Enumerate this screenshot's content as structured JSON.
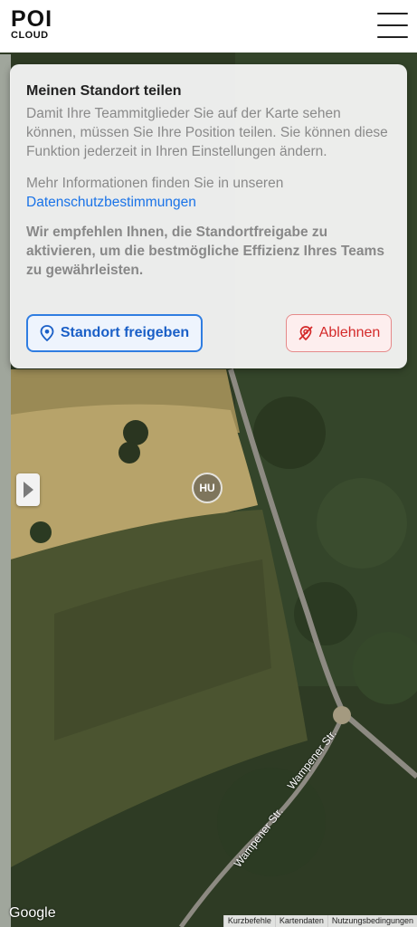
{
  "header": {
    "logo_top": "POI",
    "logo_bottom": "CLOUD"
  },
  "dialog": {
    "title": "Meinen Standort teilen",
    "paragraph1": "Damit Ihre Teammitglieder Sie auf der Karte sehen können, müssen Sie Ihre Position teilen. Sie können diese Funktion jederzeit in Ihren Einstellungen ändern.",
    "paragraph2": "Mehr Informationen finden Sie in unseren",
    "privacy_link": "Datenschutzbestimmungen",
    "recommendation": "Wir empfehlen Ihnen, die Standortfreigabe zu aktivieren, um die bestmögliche Effizienz Ihres Teams zu gewährleisten.",
    "share_button": "Standort freigeben",
    "decline_button": "Ablehnen"
  },
  "map": {
    "marker_label": "HU",
    "street_label_1": "Wampener Str.",
    "street_label_2": "Wampener Str.",
    "google_logo": "Google",
    "attribution": [
      "Kurzbefehle",
      "Kartendaten",
      "Nutzungsbedingungen"
    ]
  },
  "colors": {
    "primary": "#2f7de1",
    "danger": "#d42a2a",
    "link": "#1a73e8"
  }
}
